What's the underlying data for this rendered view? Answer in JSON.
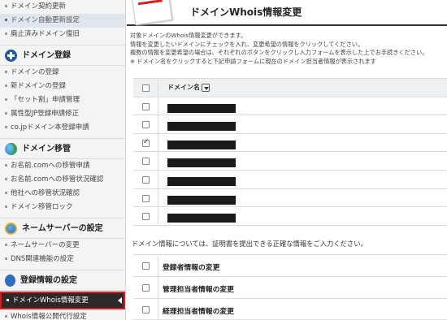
{
  "sidebar": {
    "top_items": [
      "ドメイン契約更新",
      "ドメイン自動更新設定",
      "廃止済みドメイン復旧"
    ],
    "sections": [
      {
        "title": "ドメイン登録",
        "icon": "plus-circle-icon",
        "items": [
          "ドメインの登録",
          "新ドメインの登録",
          "「セット割」申請管理",
          "属性型JP登録申請修正",
          "co.jpドメイン本登録申請"
        ]
      },
      {
        "title": "ドメイン移管",
        "icon": "globe-icon",
        "items": [
          "お名前.comへの移管申請",
          "お名前.comへの移管状況確認",
          "他社への移管状況確認",
          "ドメイン移管ロック"
        ]
      },
      {
        "title": "ネームサーバーの設定",
        "icon": "server-icon",
        "items": [
          "ネームサーバーの変更",
          "DNS関連機能の設定"
        ]
      },
      {
        "title": "登録情報の設定",
        "icon": "document-icon",
        "items": [
          "ドメインWhois情報変更",
          "Whois情報公開代行設定"
        ]
      }
    ]
  },
  "main": {
    "title": "ドメインWhois情報変更",
    "intro": [
      "対象ドメインのWhois情報変更ができます。",
      "情報を変更したいドメインにチェックを入れ、変更希望の情報をクリックしてください。",
      "複数の情報を変更希望の場合は、それぞれのボタンをクリックし入力フォームを表示した上でお手続きください。",
      "※ ドメイン名をクリックすると下記申請フォームに現在のドメイン担当者情報が表示されます"
    ],
    "domain_table": {
      "header": "ドメイン名",
      "rows": [
        {
          "checked": false
        },
        {
          "checked": false
        },
        {
          "checked": true
        },
        {
          "checked": false
        },
        {
          "checked": false
        },
        {
          "checked": false
        },
        {
          "checked": false
        }
      ]
    },
    "info_note": "ドメイン情報については、証明書を提出できる正確な情報をご入力ください。",
    "options": [
      "登録者情報の変更",
      "管理担当者情報の変更",
      "経理担当者情報の変更"
    ]
  }
}
